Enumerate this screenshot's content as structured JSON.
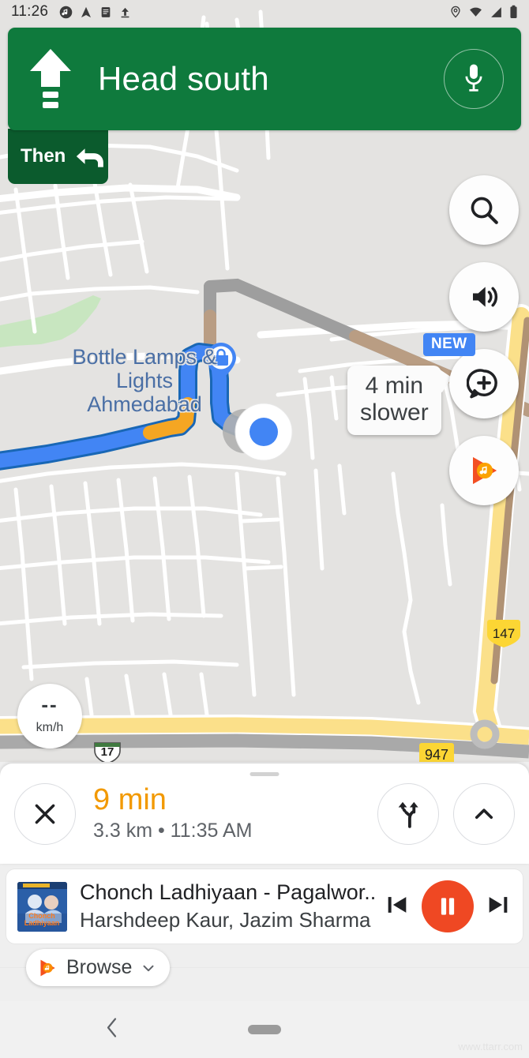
{
  "status_bar": {
    "time": "11:26",
    "left_icons": [
      "music-note-icon",
      "navigation-arrow-icon",
      "document-icon",
      "upload-icon"
    ],
    "right_icons": [
      "location-icon",
      "wifi-icon",
      "cellular-signal-icon",
      "battery-icon"
    ]
  },
  "navigation": {
    "instruction": "Head south",
    "maneuver_icon": "straight-arrow-icon",
    "mic_icon": "microphone-icon",
    "then_label": "Then",
    "then_icon": "turn-left-icon",
    "banner_color": "#0f7a3d",
    "then_color": "#0b5b2d"
  },
  "map": {
    "poi_label": "Bottle Lamps &\nLights Ahmedabad",
    "poi_line1": "Bottle Lamps &",
    "poi_line2": "Lights Ahmedabad",
    "poi_marker_icon": "shopping-bag-pin-icon",
    "callout_line1": "4 min",
    "callout_line2": "slower",
    "route_color": "#4285f4",
    "traffic_slow_color": "#f5a623",
    "road_shields": [
      {
        "label": "17",
        "style": "us-shield"
      },
      {
        "label": "147",
        "style": "yellow-shield"
      },
      {
        "label": "947",
        "style": "yellow-rect"
      }
    ],
    "speedometer": {
      "value": "--",
      "unit": "km/h"
    }
  },
  "map_buttons": [
    {
      "name": "search-button",
      "icon": "search-icon",
      "badge": null
    },
    {
      "name": "sound-button",
      "icon": "volume-on-icon",
      "badge": null
    },
    {
      "name": "report-button",
      "icon": "add-report-bubble-icon",
      "badge": "NEW"
    },
    {
      "name": "media-shortcut-button",
      "icon": "music-play-icon",
      "badge": null
    }
  ],
  "eta_panel": {
    "close_icon": "close-x-icon",
    "duration": "9 min",
    "details": "3.3 km  •  11:35 AM",
    "distance": "3.3 km",
    "arrival_time": "11:35 AM",
    "alt_routes_icon": "alternate-routes-icon",
    "expand_icon": "chevron-up-icon",
    "duration_color": "#f29900"
  },
  "media_player": {
    "title": "Chonch Ladhiyaan - Pagalwor...",
    "artist": "Harshdeep Kaur, Jazim Sharma - Pa...",
    "album_art": "album-art-thumbnail",
    "previous_icon": "skip-previous-icon",
    "play_pause_icon": "pause-icon",
    "next_icon": "skip-next-icon",
    "accent_color": "#ef4823",
    "browse_label": "Browse",
    "browse_icon": "music-play-icon",
    "browse_chevron": "chevron-down-icon"
  },
  "system_nav": {
    "back_icon": "back-chevron-icon",
    "home_icon": "home-pill-icon"
  },
  "watermark": "www.ttarr.com"
}
